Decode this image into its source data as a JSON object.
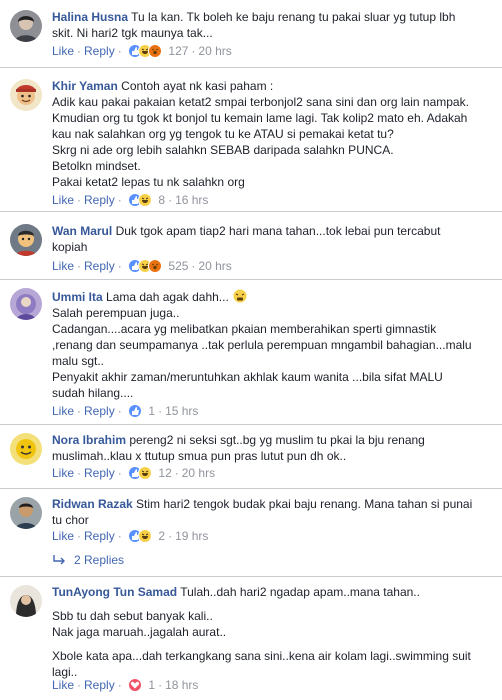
{
  "actions": {
    "like": "Like",
    "reply": "Reply",
    "sep": "·"
  },
  "comments": [
    {
      "author": "Halina Husna",
      "lines": [
        "Tu la kan. Tk boleh ke baju renang tu pakai sluar yg tutup lbh",
        "skit. Ni hari2 tgk maunya tak..."
      ],
      "reactions": [
        "like",
        "haha",
        "wow"
      ],
      "count": "127",
      "time": "20 hrs"
    },
    {
      "author": "Khir Yaman",
      "lines": [
        "Contoh ayat nk kasi paham :",
        "Adik kau pakai pakaian ketat2 smpai terbonjol2 sana sini dan org lain nampak.",
        "Kmudian org tu tgok kt bonjol tu kemain lame lagi. Tak kolip2 mato eh. Adakah",
        "kau nak salahkan org yg tengok tu ke ATAU si pemakai ketat tu?",
        "Skrg ni ade org lebih salahkn SEBAB daripada salahkn PUNCA.",
        "Betolkn mindset.",
        "Pakai ketat2 lepas tu nk salahkn org"
      ],
      "reactions": [
        "like",
        "haha"
      ],
      "count": "8",
      "time": "16 hrs"
    },
    {
      "author": "Wan Marul",
      "lines": [
        "Duk tgok apam tiap2 hari mana tahan...tok lebai pun tercabut",
        "kopiah"
      ],
      "reactions": [
        "like",
        "haha",
        "wow"
      ],
      "count": "525",
      "time": "20 hrs"
    },
    {
      "author": "Ummi Ita",
      "lines": [
        "Lama dah agak dahh...",
        "Salah perempuan juga..",
        "Cadangan....acara yg melibatkan pkaian memberahikan sperti gimnastik",
        ",renang dan seumpamanya ..tak perlula perempuan mngambil bahagian...malu",
        "malu sgt..",
        "Penyakit akhir zaman/meruntuhkan akhlak kaum wanita ...bila sifat MALU",
        "sudah hilang...."
      ],
      "reactions": [
        "like"
      ],
      "count": "1",
      "time": "15 hrs"
    },
    {
      "author": "Nora Ibrahim",
      "lines": [
        "pereng2 ni seksi sgt..bg yg muslim tu pkai la bju renang",
        "muslimah..klau x ttutup smua pun pras lutut pun dh ok.."
      ],
      "reactions": [
        "like",
        "haha"
      ],
      "count": "12",
      "time": "20 hrs"
    },
    {
      "author": "Ridwan Razak",
      "lines": [
        "Stim hari2 tengok budak pkai baju renang. Mana tahan si punai",
        "tu chor"
      ],
      "reactions": [
        "like",
        "haha"
      ],
      "count": "2",
      "time": "19 hrs",
      "replies": "2 Replies"
    },
    {
      "author": "TunAyong Tun Samad",
      "lines": [
        "Tulah..dah hari2 ngadap apam..mana tahan..",
        "",
        "Sbb tu dah sebut banyak kali..",
        "Nak jaga maruah..jagalah aurat..",
        "",
        "Xbole kata apa...dah terkangkang sana sini..kena air kolam lagi..swimming suit",
        "lagi.."
      ],
      "reactions": [
        "love"
      ],
      "count": "1",
      "time": "18 hrs"
    }
  ],
  "colors": {
    "name": "#365899",
    "link": "#4267b2",
    "meta": "#90949c",
    "divider": "#c9ccd1"
  }
}
